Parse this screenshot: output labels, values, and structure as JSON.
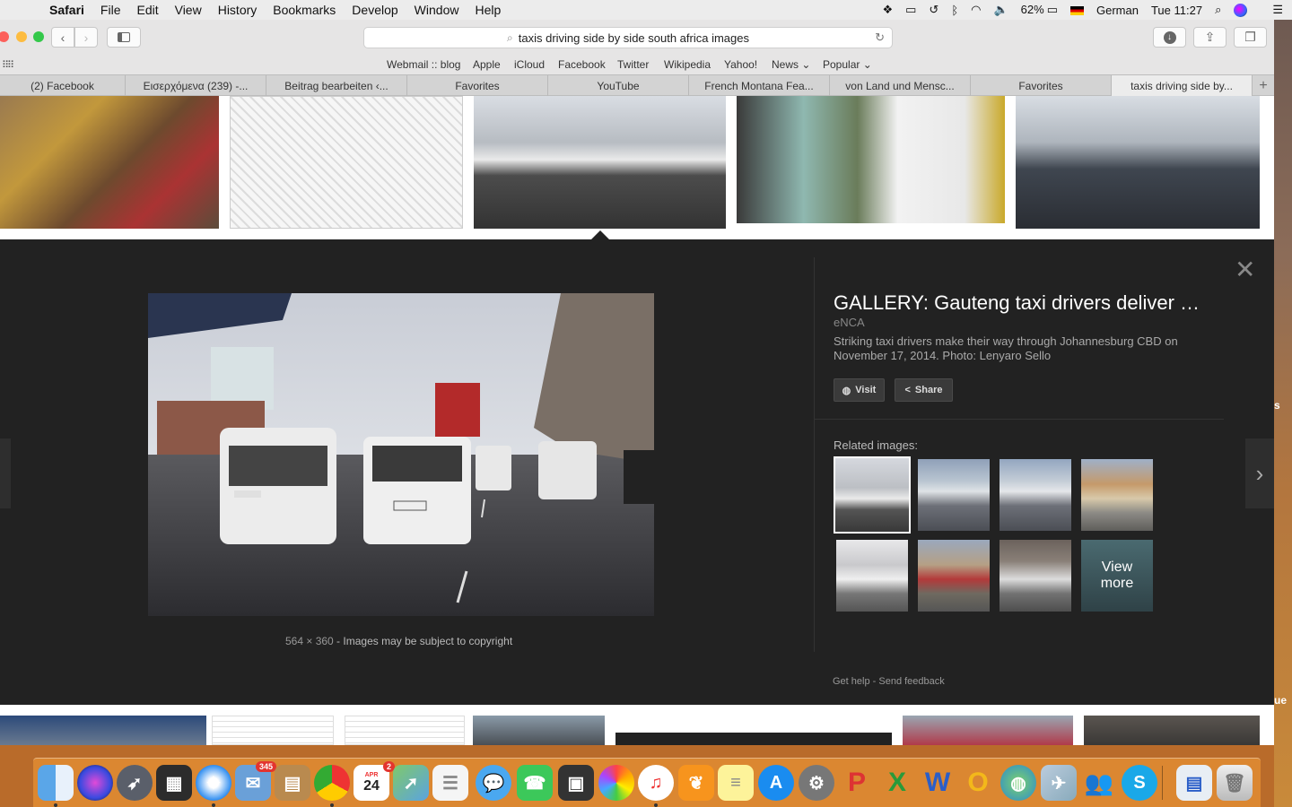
{
  "menubar": {
    "app": "Safari",
    "items": [
      "File",
      "Edit",
      "View",
      "History",
      "Bookmarks",
      "Develop",
      "Window",
      "Help"
    ],
    "battery": "62%",
    "input_source": "German",
    "clock": "Tue 11:27"
  },
  "toolbar": {
    "url": "taxis driving side by side south africa images"
  },
  "favorites": [
    "Webmail :: blog",
    "Apple",
    "iCloud",
    "Facebook",
    "Twitter",
    "Wikipedia",
    "Yahoo!",
    "News",
    "Popular"
  ],
  "tabs": [
    "(2) Facebook",
    "Εισερχόμενα (239) -...",
    "Beitrag bearbeiten ‹...",
    "Favorites",
    "YouTube",
    "French Montana Fea...",
    "von Land und Mensc...",
    "Favorites",
    "taxis driving side by..."
  ],
  "viewer": {
    "title": "GALLERY: Gauteng taxi drivers deliver …",
    "source": "eNCA",
    "description": "Striking taxi drivers make their way through Johannesburg CBD on November 17, 2014. Photo: Lenyaro Sello",
    "visit_label": "Visit",
    "share_label": "Share",
    "dimensions": "564 × 360",
    "separator": " - ",
    "copyright": "Images may be subject to copyright",
    "related_label": "Related images:",
    "view_more_line1": "View",
    "view_more_line2": "more",
    "get_help": "Get help",
    "send_feedback": "Send feedback"
  },
  "desktop_labels": [
    "s",
    "ue"
  ],
  "dock": {
    "mail_badge": "345",
    "calendar_badge": "2",
    "calendar_month": "APR",
    "calendar_day": "24"
  }
}
